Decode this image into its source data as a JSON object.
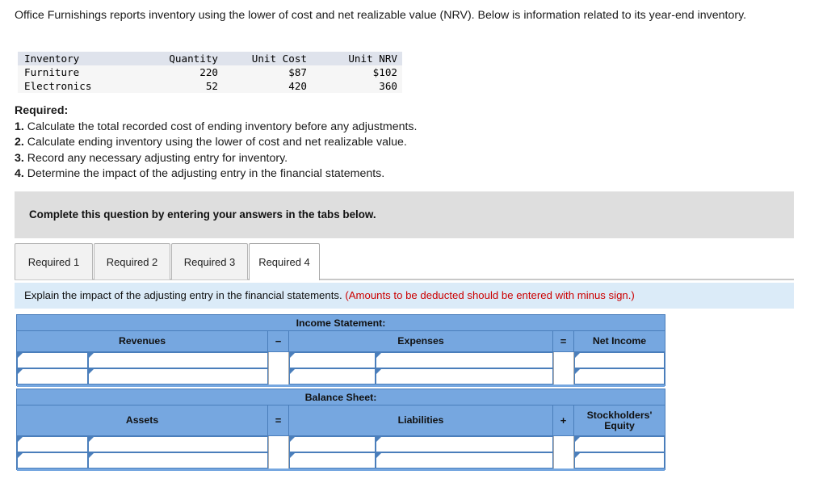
{
  "intro": {
    "paragraph": "Office Furnishings reports inventory using the lower of cost and net realizable value (NRV). Below is information related to its year-end inventory."
  },
  "inventory_table": {
    "columns": [
      "Inventory",
      "Quantity",
      "Unit Cost",
      "Unit NRV"
    ],
    "rows": [
      [
        "Furniture",
        "220",
        "$87",
        "$102"
      ],
      [
        "Electronics",
        "52",
        "420",
        "360"
      ]
    ]
  },
  "required": {
    "title": "Required:",
    "items": [
      {
        "num": "1.",
        "text": "Calculate the total recorded cost of ending inventory before any adjustments."
      },
      {
        "num": "2.",
        "text": "Calculate ending inventory using the lower of cost and net realizable value."
      },
      {
        "num": "3.",
        "text": "Record any necessary adjusting entry for inventory."
      },
      {
        "num": "4.",
        "text": "Determine the impact of the adjusting entry in the financial statements."
      }
    ]
  },
  "banner": {
    "text": "Complete this question by entering your answers in the tabs below."
  },
  "tabs": {
    "items": [
      {
        "label": "Required 1",
        "active": false
      },
      {
        "label": "Required 2",
        "active": false
      },
      {
        "label": "Required 3",
        "active": false
      },
      {
        "label": "Required 4",
        "active": true
      }
    ]
  },
  "instruction": {
    "text": "Explain the impact of the adjusting entry in the financial statements.",
    "note": "(Amounts to be deducted should be entered with minus sign.)"
  },
  "income_statement": {
    "title": "Income Statement:",
    "headers": {
      "revenues": "Revenues",
      "op1": "−",
      "expenses": "Expenses",
      "op2": "=",
      "net_income": "Net Income"
    },
    "rows": [
      {
        "rev_label": "",
        "rev_value": "",
        "exp_label": "",
        "exp_value": "",
        "net_value": ""
      },
      {
        "rev_label": "",
        "rev_value": "",
        "exp_label": "",
        "exp_value": "",
        "net_value": ""
      }
    ]
  },
  "balance_sheet": {
    "title": "Balance Sheet:",
    "headers": {
      "assets": "Assets",
      "op1": "=",
      "liabilities": "Liabilities",
      "op2": "+",
      "equity": "Stockholders' Equity"
    },
    "rows": [
      {
        "ast_label": "",
        "ast_value": "",
        "lia_label": "",
        "lia_value": "",
        "eq_value": ""
      },
      {
        "ast_label": "",
        "ast_value": "",
        "lia_label": "",
        "lia_value": "",
        "eq_value": ""
      }
    ]
  },
  "colors": {
    "header_blue": "#76a7e0",
    "border_blue": "#4a7ebb",
    "instruction_blue": "#dbebf8",
    "banner_gray": "#dedede",
    "note_red": "#cc0000"
  }
}
